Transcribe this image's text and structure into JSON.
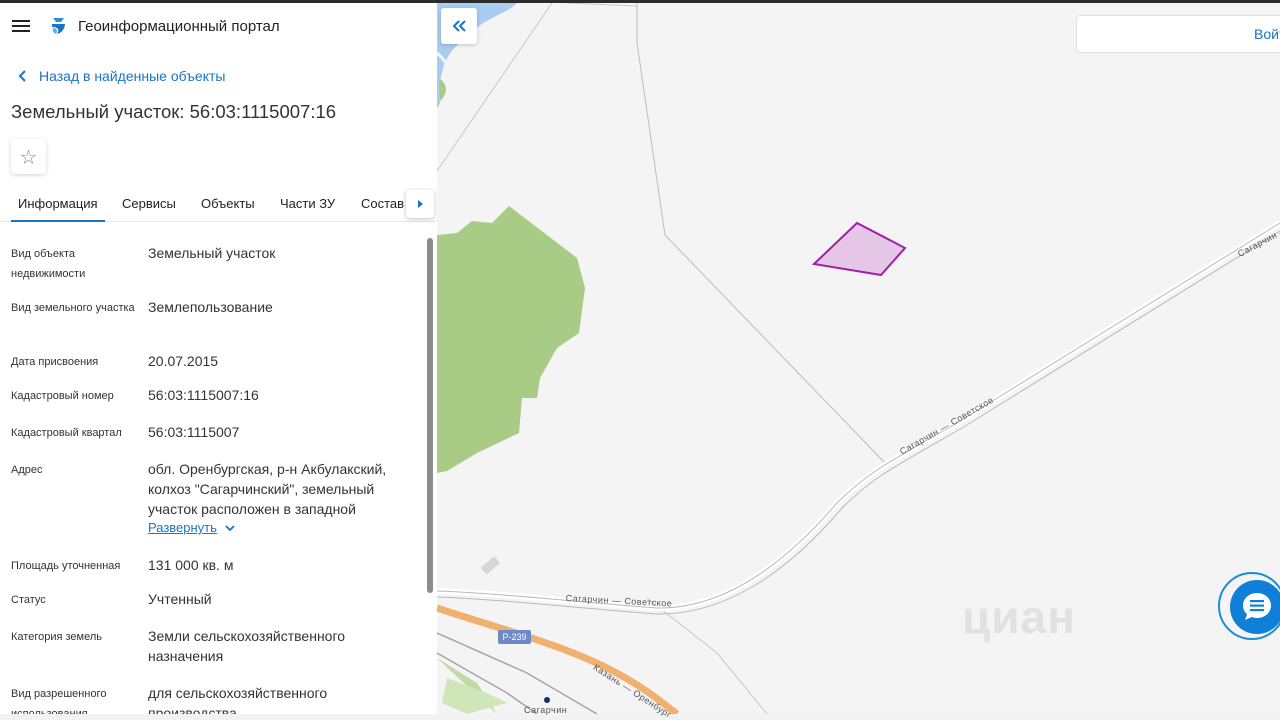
{
  "header": {
    "portal_title": "Геоинформационный портал"
  },
  "navigation": {
    "back_label": "Назад в найденные объекты"
  },
  "object": {
    "title": "Земельный участок: 56:03:1115007:16"
  },
  "tabs": [
    {
      "label": "Информация",
      "active": true
    },
    {
      "label": "Сервисы",
      "active": false
    },
    {
      "label": "Объекты",
      "active": false
    },
    {
      "label": "Части ЗУ",
      "active": false
    },
    {
      "label": "Состав",
      "active": false
    }
  ],
  "properties": [
    {
      "label": "Вид объекта недвижимости",
      "value": "Земельный участок"
    },
    {
      "label": "Вид земельного участка",
      "value": "Землепользование"
    },
    {
      "label": "Дата присвоения",
      "value": "20.07.2015"
    },
    {
      "label": "Кадастровый номер",
      "value": "56:03:1115007:16"
    },
    {
      "label": "Кадастровый квартал",
      "value": "56:03:1115007"
    },
    {
      "label": "Адрес",
      "value": "обл. Оренбургская, р-н Акбулакский, колхоз \"Сагарчинский\", земельный участок расположен в западной"
    },
    {
      "label": "Площадь уточненная",
      "value": "131 000 кв. м"
    },
    {
      "label": "Статус",
      "value": "Учтенный"
    },
    {
      "label": "Категория земель",
      "value": "Земли сельскохозяйственного назначения"
    },
    {
      "label": "Вид разрешенного использования",
      "value": "для сельскохозяйственного производства"
    }
  ],
  "address_expand_label": "Развернуть",
  "map": {
    "login_label": "Войти",
    "road_labels": {
      "sagarchin_sovetskoe_1": "Сагарчин — Советское",
      "sagarchin_sovetskoe_2": "Сагарчин — Советское",
      "sagarchin_top": "Сагарчин —",
      "kazan_orenburg": "Казань — Оренбург",
      "sagarchin_village": "Сагарчин"
    },
    "highway_shield": "Р-239",
    "watermark": "циан",
    "colors": {
      "parcel_fill": "#e6c6e6",
      "parcel_stroke": "#a020a8",
      "forest": "#a8cc85",
      "river": "#a9cdf0",
      "highway": "#f0b070"
    }
  },
  "colors": {
    "accent": "#1a73c7"
  }
}
